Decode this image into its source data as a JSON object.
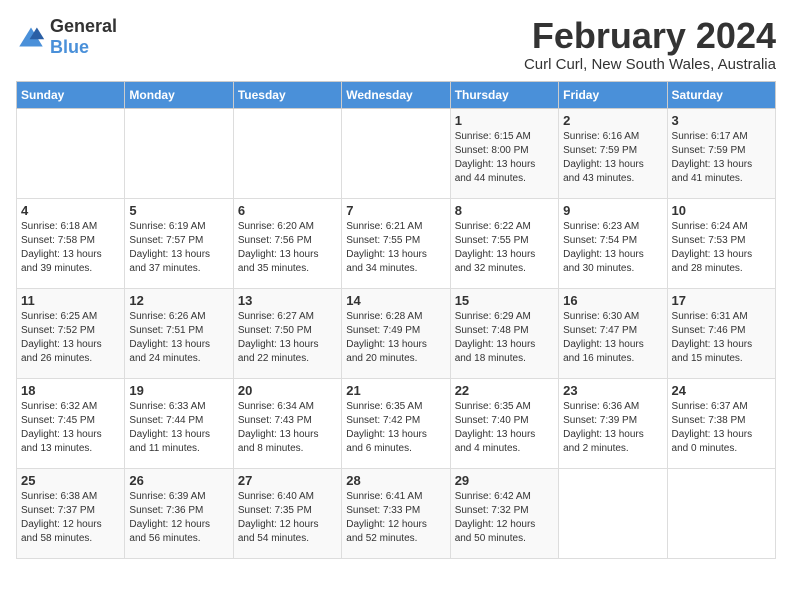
{
  "header": {
    "logo_general": "General",
    "logo_blue": "Blue",
    "month_title": "February 2024",
    "location": "Curl Curl, New South Wales, Australia"
  },
  "days_of_week": [
    "Sunday",
    "Monday",
    "Tuesday",
    "Wednesday",
    "Thursday",
    "Friday",
    "Saturday"
  ],
  "weeks": [
    [
      {
        "day": "",
        "info": ""
      },
      {
        "day": "",
        "info": ""
      },
      {
        "day": "",
        "info": ""
      },
      {
        "day": "",
        "info": ""
      },
      {
        "day": "1",
        "info": "Sunrise: 6:15 AM\nSunset: 8:00 PM\nDaylight: 13 hours\nand 44 minutes."
      },
      {
        "day": "2",
        "info": "Sunrise: 6:16 AM\nSunset: 7:59 PM\nDaylight: 13 hours\nand 43 minutes."
      },
      {
        "day": "3",
        "info": "Sunrise: 6:17 AM\nSunset: 7:59 PM\nDaylight: 13 hours\nand 41 minutes."
      }
    ],
    [
      {
        "day": "4",
        "info": "Sunrise: 6:18 AM\nSunset: 7:58 PM\nDaylight: 13 hours\nand 39 minutes."
      },
      {
        "day": "5",
        "info": "Sunrise: 6:19 AM\nSunset: 7:57 PM\nDaylight: 13 hours\nand 37 minutes."
      },
      {
        "day": "6",
        "info": "Sunrise: 6:20 AM\nSunset: 7:56 PM\nDaylight: 13 hours\nand 35 minutes."
      },
      {
        "day": "7",
        "info": "Sunrise: 6:21 AM\nSunset: 7:55 PM\nDaylight: 13 hours\nand 34 minutes."
      },
      {
        "day": "8",
        "info": "Sunrise: 6:22 AM\nSunset: 7:55 PM\nDaylight: 13 hours\nand 32 minutes."
      },
      {
        "day": "9",
        "info": "Sunrise: 6:23 AM\nSunset: 7:54 PM\nDaylight: 13 hours\nand 30 minutes."
      },
      {
        "day": "10",
        "info": "Sunrise: 6:24 AM\nSunset: 7:53 PM\nDaylight: 13 hours\nand 28 minutes."
      }
    ],
    [
      {
        "day": "11",
        "info": "Sunrise: 6:25 AM\nSunset: 7:52 PM\nDaylight: 13 hours\nand 26 minutes."
      },
      {
        "day": "12",
        "info": "Sunrise: 6:26 AM\nSunset: 7:51 PM\nDaylight: 13 hours\nand 24 minutes."
      },
      {
        "day": "13",
        "info": "Sunrise: 6:27 AM\nSunset: 7:50 PM\nDaylight: 13 hours\nand 22 minutes."
      },
      {
        "day": "14",
        "info": "Sunrise: 6:28 AM\nSunset: 7:49 PM\nDaylight: 13 hours\nand 20 minutes."
      },
      {
        "day": "15",
        "info": "Sunrise: 6:29 AM\nSunset: 7:48 PM\nDaylight: 13 hours\nand 18 minutes."
      },
      {
        "day": "16",
        "info": "Sunrise: 6:30 AM\nSunset: 7:47 PM\nDaylight: 13 hours\nand 16 minutes."
      },
      {
        "day": "17",
        "info": "Sunrise: 6:31 AM\nSunset: 7:46 PM\nDaylight: 13 hours\nand 15 minutes."
      }
    ],
    [
      {
        "day": "18",
        "info": "Sunrise: 6:32 AM\nSunset: 7:45 PM\nDaylight: 13 hours\nand 13 minutes."
      },
      {
        "day": "19",
        "info": "Sunrise: 6:33 AM\nSunset: 7:44 PM\nDaylight: 13 hours\nand 11 minutes."
      },
      {
        "day": "20",
        "info": "Sunrise: 6:34 AM\nSunset: 7:43 PM\nDaylight: 13 hours\nand 8 minutes."
      },
      {
        "day": "21",
        "info": "Sunrise: 6:35 AM\nSunset: 7:42 PM\nDaylight: 13 hours\nand 6 minutes."
      },
      {
        "day": "22",
        "info": "Sunrise: 6:35 AM\nSunset: 7:40 PM\nDaylight: 13 hours\nand 4 minutes."
      },
      {
        "day": "23",
        "info": "Sunrise: 6:36 AM\nSunset: 7:39 PM\nDaylight: 13 hours\nand 2 minutes."
      },
      {
        "day": "24",
        "info": "Sunrise: 6:37 AM\nSunset: 7:38 PM\nDaylight: 13 hours\nand 0 minutes."
      }
    ],
    [
      {
        "day": "25",
        "info": "Sunrise: 6:38 AM\nSunset: 7:37 PM\nDaylight: 12 hours\nand 58 minutes."
      },
      {
        "day": "26",
        "info": "Sunrise: 6:39 AM\nSunset: 7:36 PM\nDaylight: 12 hours\nand 56 minutes."
      },
      {
        "day": "27",
        "info": "Sunrise: 6:40 AM\nSunset: 7:35 PM\nDaylight: 12 hours\nand 54 minutes."
      },
      {
        "day": "28",
        "info": "Sunrise: 6:41 AM\nSunset: 7:33 PM\nDaylight: 12 hours\nand 52 minutes."
      },
      {
        "day": "29",
        "info": "Sunrise: 6:42 AM\nSunset: 7:32 PM\nDaylight: 12 hours\nand 50 minutes."
      },
      {
        "day": "",
        "info": ""
      },
      {
        "day": "",
        "info": ""
      }
    ]
  ]
}
